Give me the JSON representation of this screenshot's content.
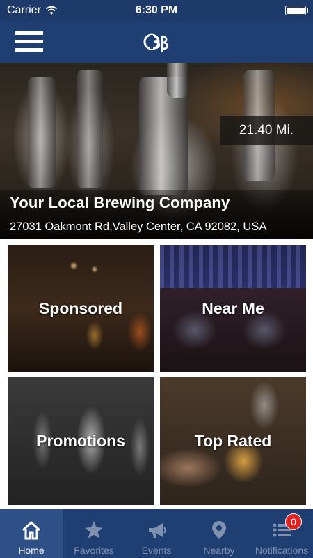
{
  "status_bar": {
    "carrier": "Carrier",
    "time": "6:30 PM",
    "battery_level": 1.0
  },
  "nav": {
    "menu_icon": "hamburger-menu-icon",
    "logo_icon": "brewery-logo-icon"
  },
  "featured": {
    "distance": "21.40 Mi.",
    "name": "Your Local Brewing Company",
    "address": "27031 Oakmont Rd,Valley Center, CA 92082, USA"
  },
  "tiles": [
    {
      "label": "Sponsored"
    },
    {
      "label": "Near Me"
    },
    {
      "label": "Promotions"
    },
    {
      "label": "Top Rated"
    }
  ],
  "tab_bar": {
    "tabs": [
      {
        "label": "Home",
        "icon": "home-icon",
        "active": true
      },
      {
        "label": "Favorites",
        "icon": "star-icon",
        "active": false
      },
      {
        "label": "Events",
        "icon": "megaphone-icon",
        "active": false
      },
      {
        "label": "Nearby",
        "icon": "map-pin-icon",
        "active": false
      },
      {
        "label": "Notifications",
        "icon": "list-icon",
        "active": false,
        "badge": "0"
      }
    ]
  },
  "colors": {
    "nav_blue": "#1f3e72",
    "active_tab": "#2f5087",
    "inactive_tab_text": "#8090b0",
    "badge_red": "#e02222"
  }
}
